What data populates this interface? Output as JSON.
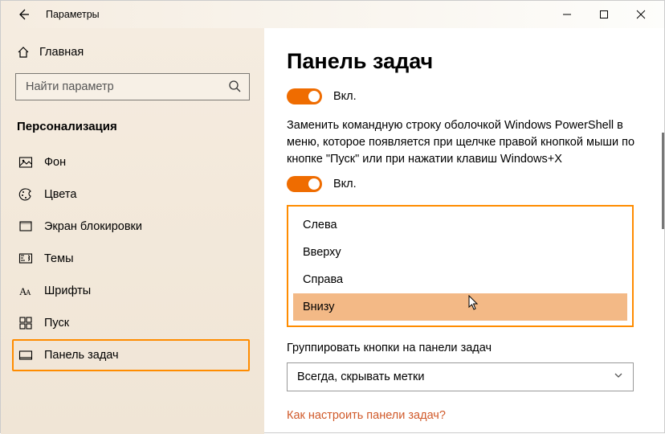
{
  "window": {
    "title": "Параметры"
  },
  "sidebar": {
    "home": "Главная",
    "search_placeholder": "Найти параметр",
    "section": "Персонализация",
    "items": [
      {
        "label": "Фон"
      },
      {
        "label": "Цвета"
      },
      {
        "label": "Экран блокировки"
      },
      {
        "label": "Темы"
      },
      {
        "label": "Шрифты"
      },
      {
        "label": "Пуск"
      },
      {
        "label": "Панель задач"
      }
    ]
  },
  "content": {
    "title": "Панель задач",
    "toggle1_label": "Вкл.",
    "description": "Заменить командную строку оболочкой Windows PowerShell в меню, которое появляется при щелчке правой кнопкой мыши по кнопке \"Пуск\" или при нажатии клавиш Windows+X",
    "toggle2_label": "Вкл.",
    "position_options": {
      "0": "Слева",
      "1": "Вверху",
      "2": "Справа",
      "3": "Внизу"
    },
    "group_label": "Группировать кнопки на панели задач",
    "group_value": "Всегда, скрывать метки",
    "help_link": "Как настроить панели задач?"
  }
}
